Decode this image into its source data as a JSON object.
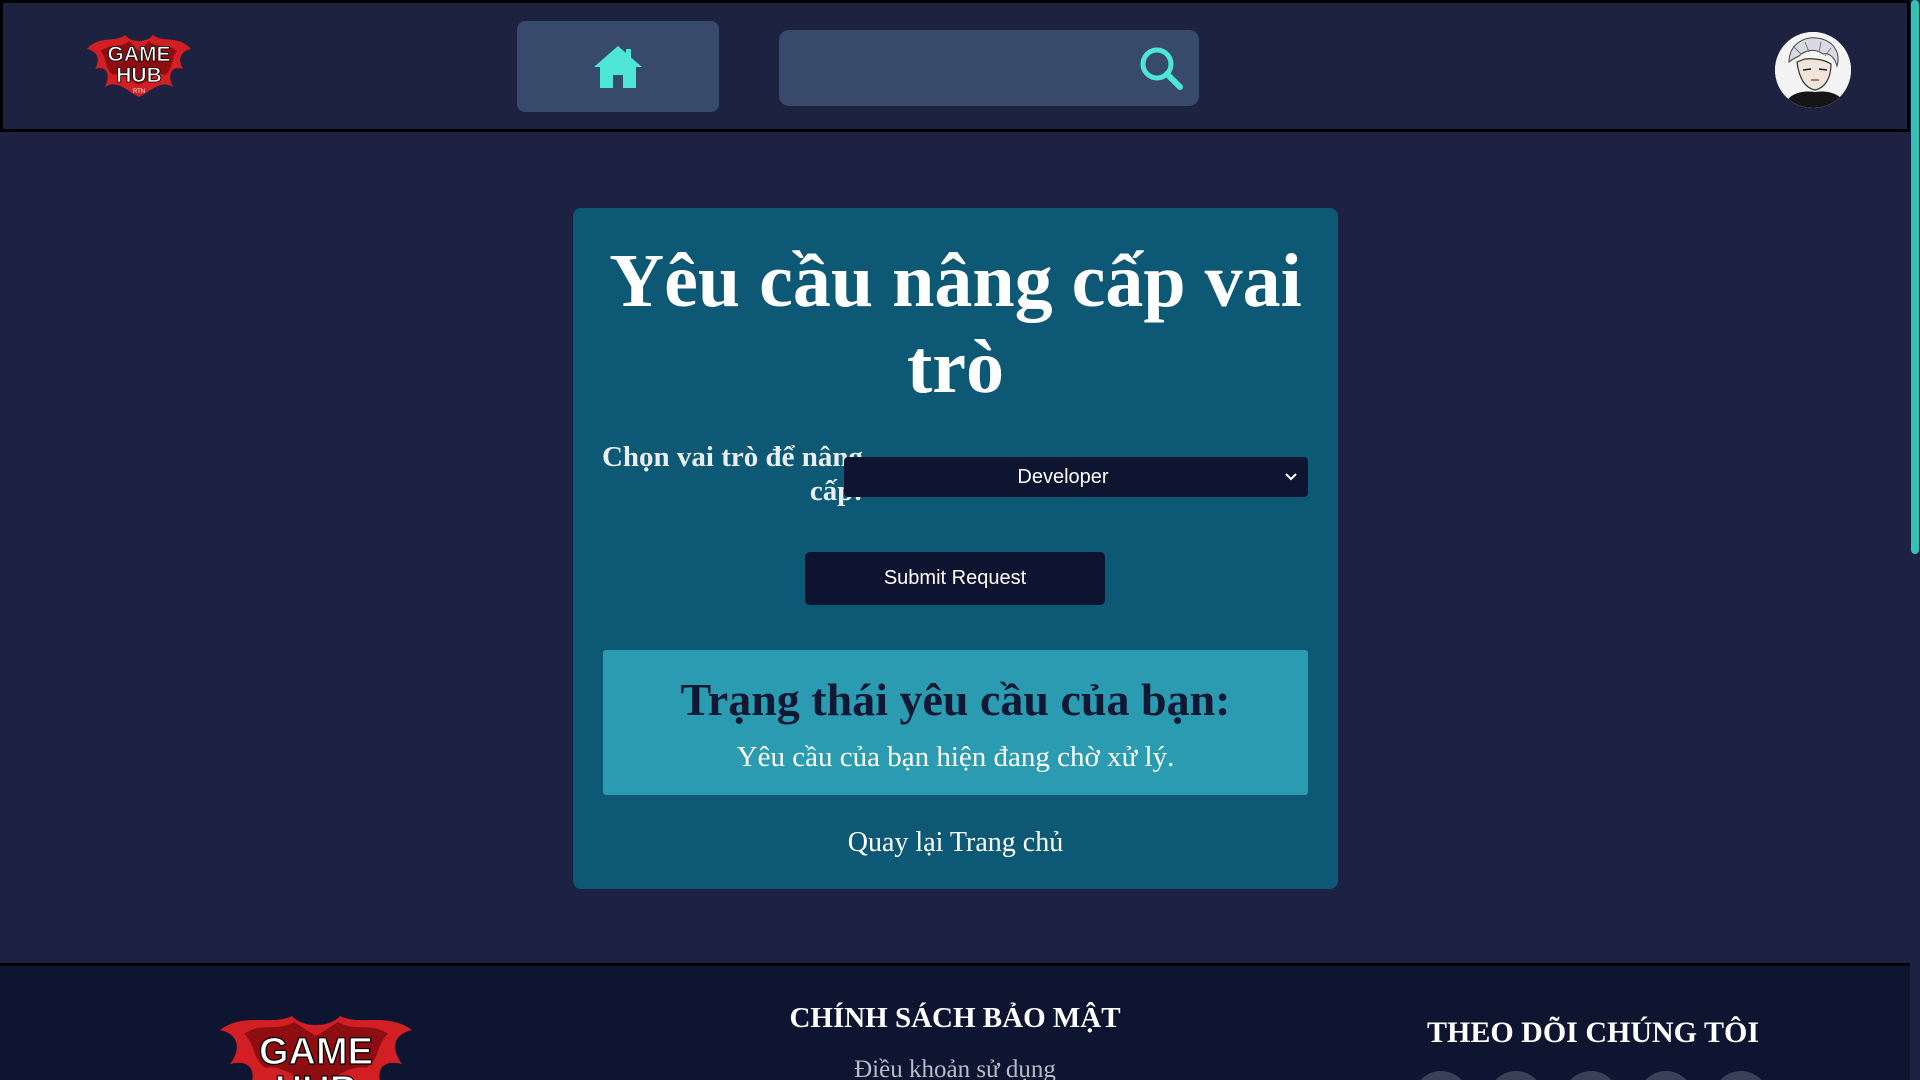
{
  "header": {
    "logo_text": [
      "GAME",
      "HUB"
    ],
    "logo_subtext": "RTN",
    "search": {
      "value": "",
      "placeholder": ""
    },
    "colors": {
      "accent": "#4ee6d6",
      "button_bg": "#374a6c",
      "bg": "#1c2240"
    }
  },
  "card": {
    "title": "Yêu cầu nâng cấp vai trò",
    "role_label": "Chọn vai trò để nâng cấp:",
    "role_selected": "Developer",
    "submit_label": "Submit Request",
    "status_title": "Trạng thái yêu cầu của bạn:",
    "status_text": "Yêu cầu của bạn hiện đang chờ xử lý.",
    "back_link": "Quay lại Trang chủ",
    "colors": {
      "card_bg": "#0d5875",
      "status_bg": "#2b9bb1"
    }
  },
  "footer": {
    "logo_text": [
      "GAME",
      "HUB"
    ],
    "policy_title": "CHÍNH SÁCH BẢO MẬT",
    "terms_link": "Điều khoản sử dụng",
    "follow_title": "THEO DÕI CHÚNG TÔI",
    "social_icons": [
      "social-icon-1",
      "social-icon-2",
      "social-icon-3",
      "social-icon-4",
      "social-icon-5"
    ]
  }
}
